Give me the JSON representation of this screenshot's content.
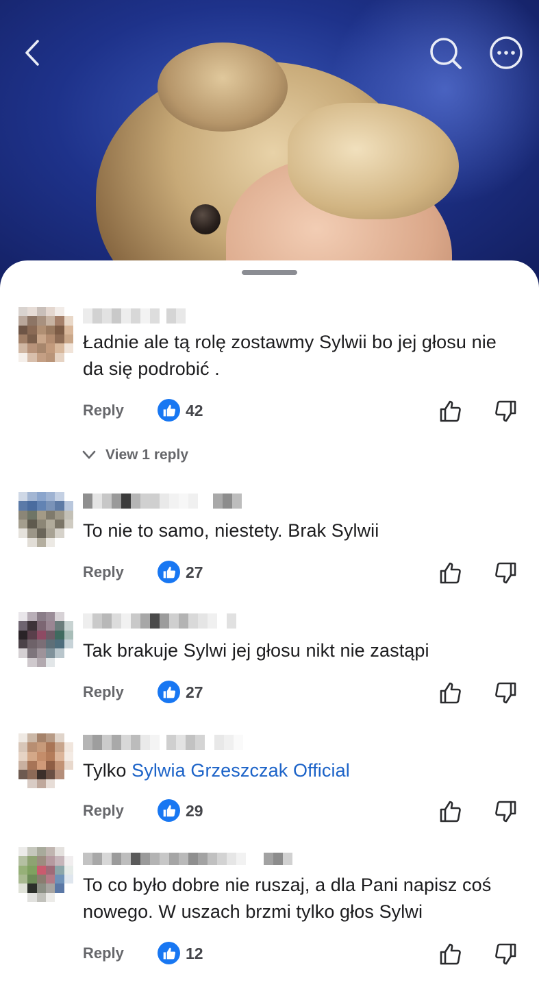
{
  "header": {
    "back_icon": "chevron-left-icon",
    "search_icon": "search-icon",
    "more_icon": "more-horizontal-icon"
  },
  "comments": [
    {
      "text": "Ładnie ale tą rolę zostawmy Sylwii bo jej  głosu nie da się podrobić .",
      "reply_label": "Reply",
      "likes": "42",
      "view_replies": "View 1 reply"
    },
    {
      "text": "To nie to samo, niestety. Brak Sylwii",
      "reply_label": "Reply",
      "likes": "27"
    },
    {
      "text": "Tak brakuje Sylwi jej głosu nikt nie zastąpi",
      "reply_label": "Reply",
      "likes": "27"
    },
    {
      "text_prefix": "Tylko ",
      "mention": "Sylwia Grzeszczak Official",
      "reply_label": "Reply",
      "likes": "29"
    },
    {
      "text": "To co było dobre nie ruszaj, a dla Pani napisz coś nowego. W uszach brzmi tylko głos  Sylwi",
      "reply_label": "Reply",
      "likes": "12"
    }
  ],
  "colors": {
    "like_badge": "#1877f2",
    "mention_link": "#1c63c8",
    "secondary_text": "#66676b"
  }
}
